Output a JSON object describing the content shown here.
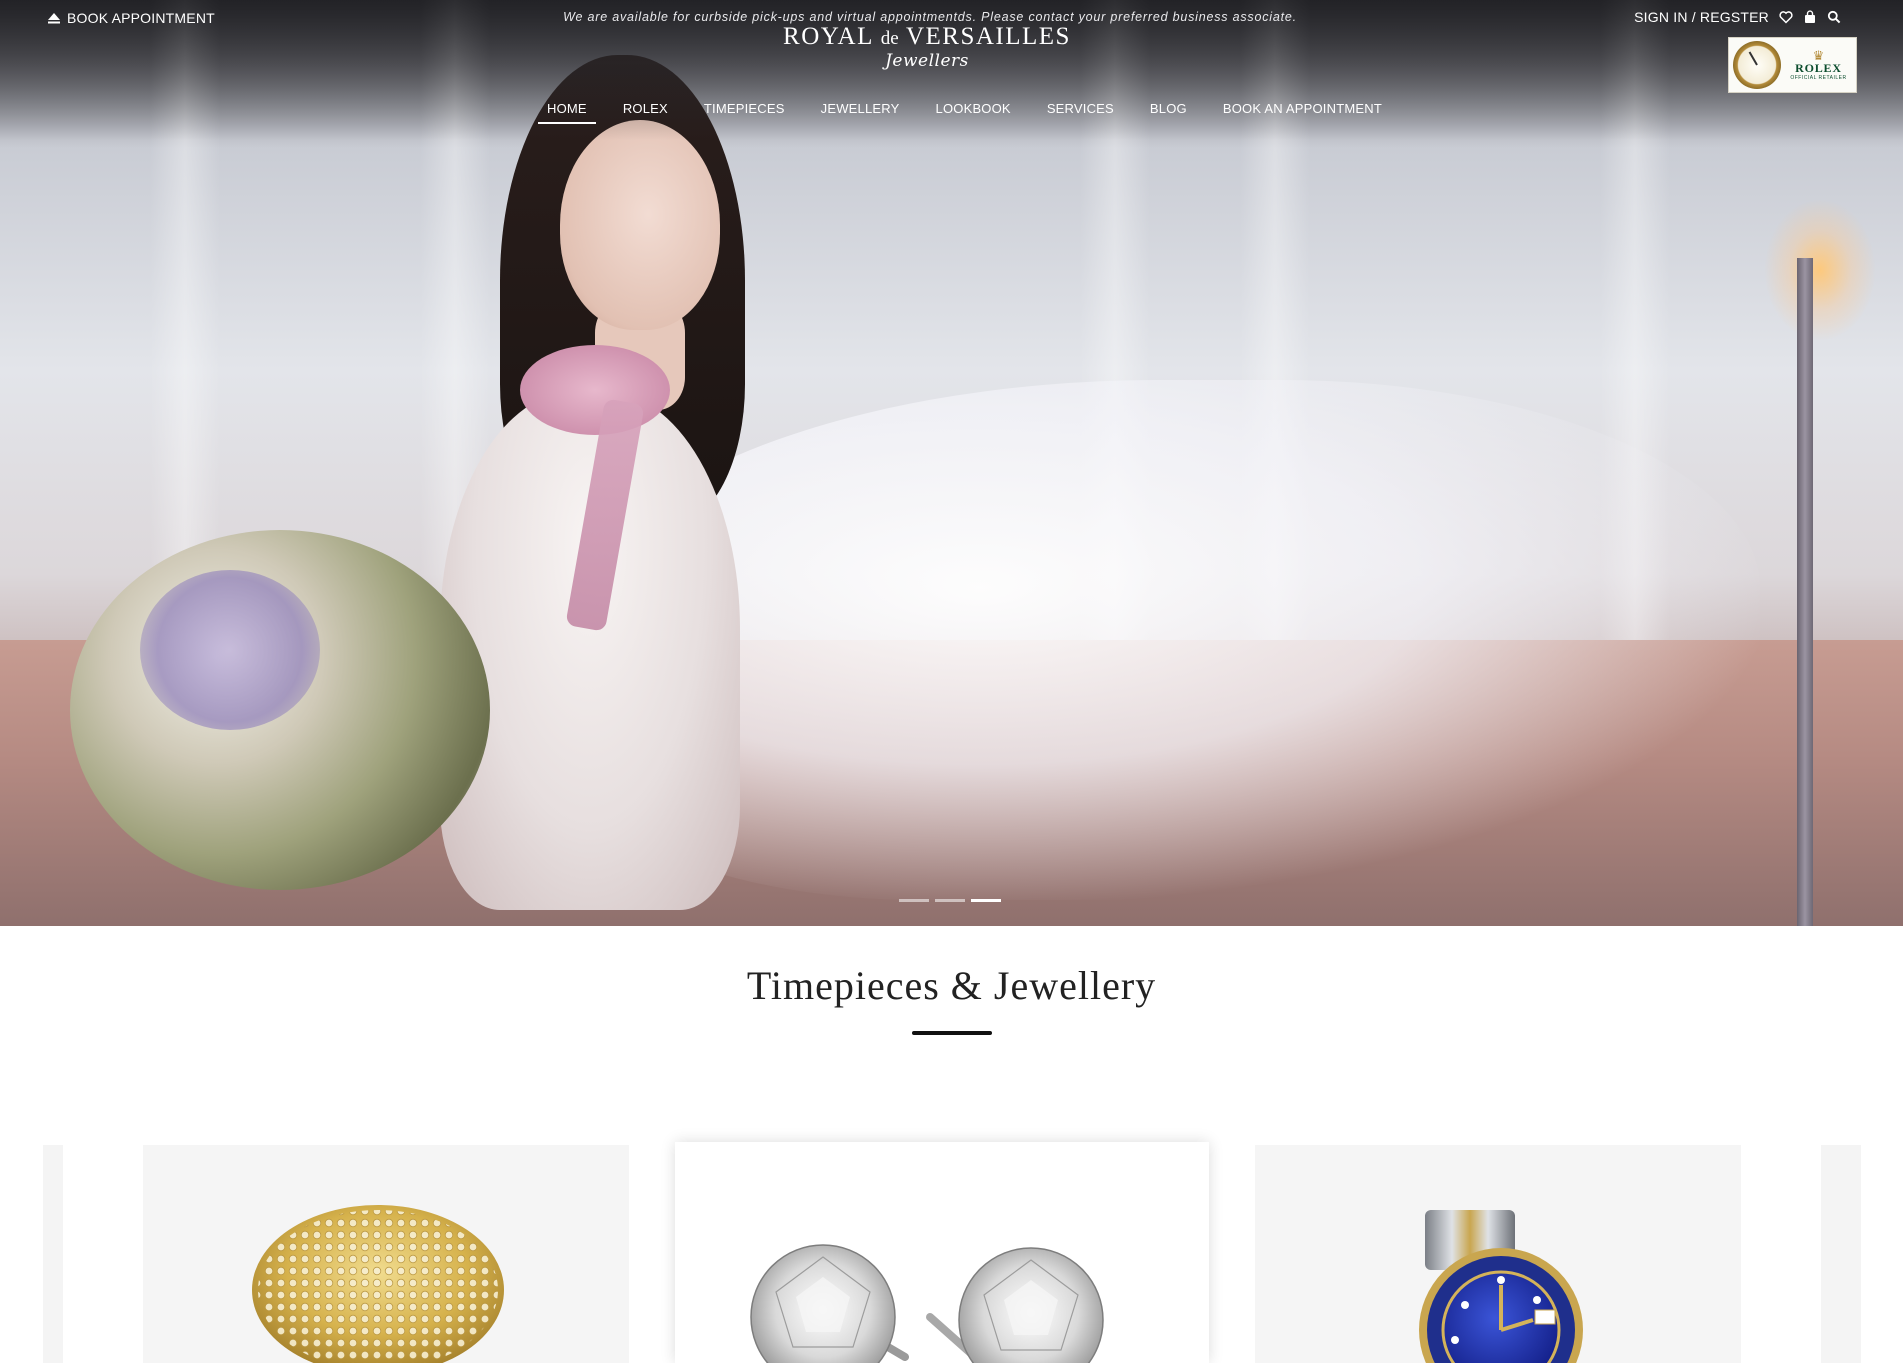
{
  "header": {
    "book_appointment": "BOOK APPOINTMENT",
    "announcement": "We are available for curbside pick-ups and virtual appointmentds. Please contact your preferred business associate.",
    "logo_main_1": "ROYAL",
    "logo_main_de": "de",
    "logo_main_2": "VERSAILLES",
    "logo_sub": "Jewellers",
    "sign_in": "SIGN IN / REGSTER",
    "rolex_badge": {
      "brand": "ROLEX",
      "tagline": "OFFICIAL RETAILER"
    }
  },
  "nav": {
    "items": [
      {
        "label": "HOME",
        "active": true
      },
      {
        "label": "ROLEX"
      },
      {
        "label": "TIMEPIECES"
      },
      {
        "label": "JEWELLERY"
      },
      {
        "label": "LOOKBOOK"
      },
      {
        "label": "SERVICES"
      },
      {
        "label": "BLOG"
      },
      {
        "label": "BOOK AN APPOINTMENT"
      }
    ]
  },
  "hero": {
    "slides_count": 3,
    "active_slide": 3
  },
  "section": {
    "title": "Timepieces & Jewellery"
  },
  "products": [
    {
      "name": "gold-pave-ring"
    },
    {
      "name": "diamond-stud-earrings"
    },
    {
      "name": "rolex-submariner-watch"
    }
  ],
  "colors": {
    "watch_bezel": "#1f2f8c",
    "gold": "#d6b24c",
    "rolex_green": "#0c4d2e"
  }
}
